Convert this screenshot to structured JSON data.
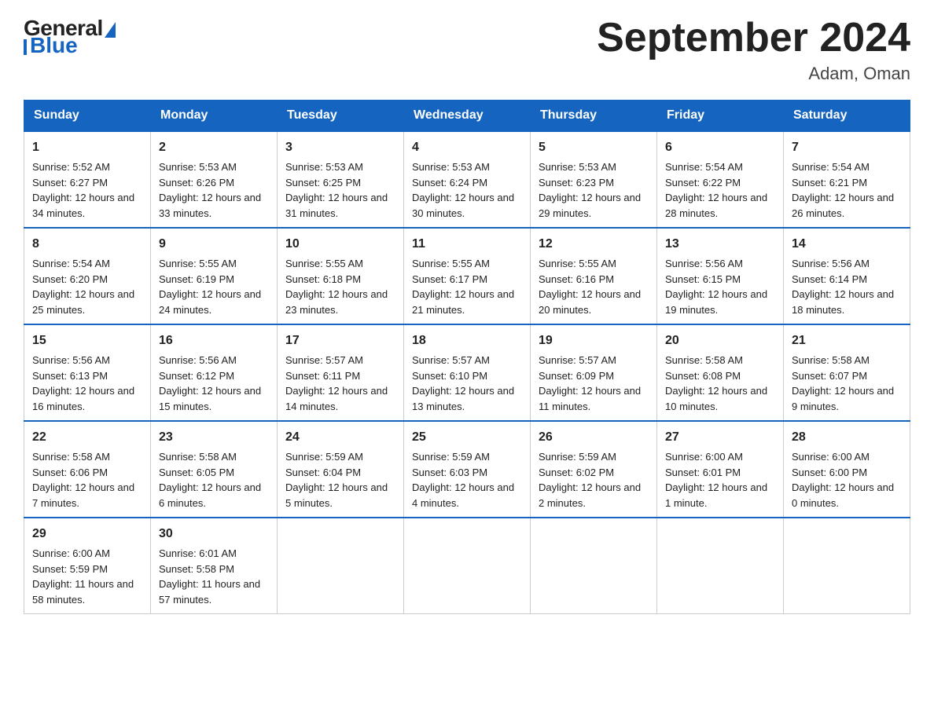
{
  "header": {
    "logo_general": "General",
    "logo_blue": "Blue",
    "month_title": "September 2024",
    "location": "Adam, Oman"
  },
  "days_of_week": [
    "Sunday",
    "Monday",
    "Tuesday",
    "Wednesday",
    "Thursday",
    "Friday",
    "Saturday"
  ],
  "weeks": [
    [
      {
        "day": "1",
        "sunrise": "5:52 AM",
        "sunset": "6:27 PM",
        "daylight": "12 hours and 34 minutes."
      },
      {
        "day": "2",
        "sunrise": "5:53 AM",
        "sunset": "6:26 PM",
        "daylight": "12 hours and 33 minutes."
      },
      {
        "day": "3",
        "sunrise": "5:53 AM",
        "sunset": "6:25 PM",
        "daylight": "12 hours and 31 minutes."
      },
      {
        "day": "4",
        "sunrise": "5:53 AM",
        "sunset": "6:24 PM",
        "daylight": "12 hours and 30 minutes."
      },
      {
        "day": "5",
        "sunrise": "5:53 AM",
        "sunset": "6:23 PM",
        "daylight": "12 hours and 29 minutes."
      },
      {
        "day": "6",
        "sunrise": "5:54 AM",
        "sunset": "6:22 PM",
        "daylight": "12 hours and 28 minutes."
      },
      {
        "day": "7",
        "sunrise": "5:54 AM",
        "sunset": "6:21 PM",
        "daylight": "12 hours and 26 minutes."
      }
    ],
    [
      {
        "day": "8",
        "sunrise": "5:54 AM",
        "sunset": "6:20 PM",
        "daylight": "12 hours and 25 minutes."
      },
      {
        "day": "9",
        "sunrise": "5:55 AM",
        "sunset": "6:19 PM",
        "daylight": "12 hours and 24 minutes."
      },
      {
        "day": "10",
        "sunrise": "5:55 AM",
        "sunset": "6:18 PM",
        "daylight": "12 hours and 23 minutes."
      },
      {
        "day": "11",
        "sunrise": "5:55 AM",
        "sunset": "6:17 PM",
        "daylight": "12 hours and 21 minutes."
      },
      {
        "day": "12",
        "sunrise": "5:55 AM",
        "sunset": "6:16 PM",
        "daylight": "12 hours and 20 minutes."
      },
      {
        "day": "13",
        "sunrise": "5:56 AM",
        "sunset": "6:15 PM",
        "daylight": "12 hours and 19 minutes."
      },
      {
        "day": "14",
        "sunrise": "5:56 AM",
        "sunset": "6:14 PM",
        "daylight": "12 hours and 18 minutes."
      }
    ],
    [
      {
        "day": "15",
        "sunrise": "5:56 AM",
        "sunset": "6:13 PM",
        "daylight": "12 hours and 16 minutes."
      },
      {
        "day": "16",
        "sunrise": "5:56 AM",
        "sunset": "6:12 PM",
        "daylight": "12 hours and 15 minutes."
      },
      {
        "day": "17",
        "sunrise": "5:57 AM",
        "sunset": "6:11 PM",
        "daylight": "12 hours and 14 minutes."
      },
      {
        "day": "18",
        "sunrise": "5:57 AM",
        "sunset": "6:10 PM",
        "daylight": "12 hours and 13 minutes."
      },
      {
        "day": "19",
        "sunrise": "5:57 AM",
        "sunset": "6:09 PM",
        "daylight": "12 hours and 11 minutes."
      },
      {
        "day": "20",
        "sunrise": "5:58 AM",
        "sunset": "6:08 PM",
        "daylight": "12 hours and 10 minutes."
      },
      {
        "day": "21",
        "sunrise": "5:58 AM",
        "sunset": "6:07 PM",
        "daylight": "12 hours and 9 minutes."
      }
    ],
    [
      {
        "day": "22",
        "sunrise": "5:58 AM",
        "sunset": "6:06 PM",
        "daylight": "12 hours and 7 minutes."
      },
      {
        "day": "23",
        "sunrise": "5:58 AM",
        "sunset": "6:05 PM",
        "daylight": "12 hours and 6 minutes."
      },
      {
        "day": "24",
        "sunrise": "5:59 AM",
        "sunset": "6:04 PM",
        "daylight": "12 hours and 5 minutes."
      },
      {
        "day": "25",
        "sunrise": "5:59 AM",
        "sunset": "6:03 PM",
        "daylight": "12 hours and 4 minutes."
      },
      {
        "day": "26",
        "sunrise": "5:59 AM",
        "sunset": "6:02 PM",
        "daylight": "12 hours and 2 minutes."
      },
      {
        "day": "27",
        "sunrise": "6:00 AM",
        "sunset": "6:01 PM",
        "daylight": "12 hours and 1 minute."
      },
      {
        "day": "28",
        "sunrise": "6:00 AM",
        "sunset": "6:00 PM",
        "daylight": "12 hours and 0 minutes."
      }
    ],
    [
      {
        "day": "29",
        "sunrise": "6:00 AM",
        "sunset": "5:59 PM",
        "daylight": "11 hours and 58 minutes."
      },
      {
        "day": "30",
        "sunrise": "6:01 AM",
        "sunset": "5:58 PM",
        "daylight": "11 hours and 57 minutes."
      },
      null,
      null,
      null,
      null,
      null
    ]
  ]
}
